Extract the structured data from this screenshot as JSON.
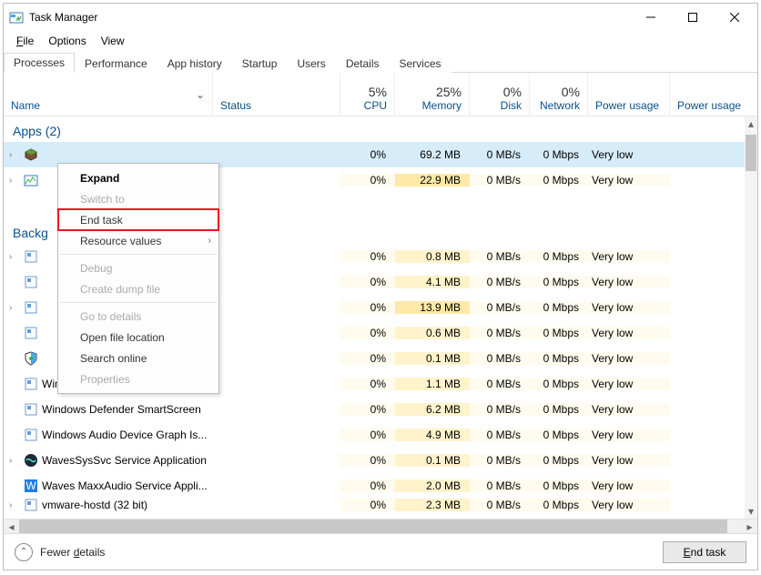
{
  "title": "Task Manager",
  "titlebar": {
    "min": "Minimize",
    "max": "Maximize",
    "close": "Close"
  },
  "menu": {
    "file": "File",
    "options": "Options",
    "view": "View"
  },
  "tabs": [
    "Processes",
    "Performance",
    "App history",
    "Startup",
    "Users",
    "Details",
    "Services"
  ],
  "active_tab": 0,
  "headers": {
    "name": "Name",
    "status": "Status",
    "cpu_top": "5%",
    "cpu_bot": "CPU",
    "mem_top": "25%",
    "mem_bot": "Memory",
    "disk_top": "0%",
    "disk_bot": "Disk",
    "net_top": "0%",
    "net_bot": "Network",
    "power": "Power usage",
    "power2": "Power usage"
  },
  "groups": {
    "apps_label": "Apps (2)",
    "bg_label": "Backg"
  },
  "rows": [
    {
      "arrow": true,
      "name": "",
      "cpu": "0%",
      "mem": "69.2 MB",
      "disk": "0 MB/s",
      "net": "0 Mbps",
      "pw": "Very low",
      "selected": true
    },
    {
      "arrow": true,
      "name": "",
      "cpu": "0%",
      "mem": "22.9 MB",
      "disk": "0 MB/s",
      "net": "0 Mbps",
      "pw": "Very low"
    },
    {
      "gap": true
    },
    {
      "arrow": true,
      "name": "",
      "cpu": "0%",
      "mem": "0.8 MB",
      "disk": "0 MB/s",
      "net": "0 Mbps",
      "pw": "Very low"
    },
    {
      "arrow": false,
      "name": "",
      "cpu": "0%",
      "mem": "4.1 MB",
      "disk": "0 MB/s",
      "net": "0 Mbps",
      "pw": "Very low"
    },
    {
      "arrow": true,
      "name": "",
      "cpu": "0%",
      "mem": "13.9 MB",
      "disk": "0 MB/s",
      "net": "0 Mbps",
      "pw": "Very low"
    },
    {
      "arrow": false,
      "name": "",
      "cpu": "0%",
      "mem": "0.6 MB",
      "disk": "0 MB/s",
      "net": "0 Mbps",
      "pw": "Very low"
    },
    {
      "arrow": false,
      "name": "",
      "cpu": "0%",
      "mem": "0.1 MB",
      "disk": "0 MB/s",
      "net": "0 Mbps",
      "pw": "Very low",
      "shield": true
    },
    {
      "arrow": false,
      "name": "Windows Security Health Service",
      "cpu": "0%",
      "mem": "1.1 MB",
      "disk": "0 MB/s",
      "net": "0 Mbps",
      "pw": "Very low"
    },
    {
      "arrow": false,
      "name": "Windows Defender SmartScreen",
      "cpu": "0%",
      "mem": "6.2 MB",
      "disk": "0 MB/s",
      "net": "0 Mbps",
      "pw": "Very low"
    },
    {
      "arrow": false,
      "name": "Windows Audio Device Graph Is...",
      "cpu": "0%",
      "mem": "4.9 MB",
      "disk": "0 MB/s",
      "net": "0 Mbps",
      "pw": "Very low"
    },
    {
      "arrow": true,
      "name": "WavesSysSvc Service Application",
      "cpu": "0%",
      "mem": "0.1 MB",
      "disk": "0 MB/s",
      "net": "0 Mbps",
      "pw": "Very low",
      "waves": true
    },
    {
      "arrow": false,
      "name": "Waves MaxxAudio Service Appli...",
      "cpu": "0%",
      "mem": "2.0 MB",
      "disk": "0 MB/s",
      "net": "0 Mbps",
      "pw": "Very low",
      "wavesblue": true
    },
    {
      "arrow": true,
      "name": "vmware-hostd (32 bit)",
      "cpu": "0%",
      "mem": "2.3 MB",
      "disk": "0 MB/s",
      "net": "0 Mbps",
      "pw": "Very low",
      "cut": true
    }
  ],
  "context_menu": {
    "items": [
      {
        "label": "Expand",
        "bold": true
      },
      {
        "label": "Switch to",
        "disabled": true
      },
      {
        "label": "End task",
        "boxed": true
      },
      {
        "label": "Resource values",
        "sub": true
      },
      {
        "label": "Debug",
        "disabled": true
      },
      {
        "label": "Create dump file",
        "disabled": true
      },
      {
        "label": "Go to details",
        "disabled": true
      },
      {
        "label": "Open file location"
      },
      {
        "label": "Search online"
      },
      {
        "label": "Properties",
        "disabled": true
      }
    ]
  },
  "footer": {
    "fewer": "Fewer details",
    "endtask": "End task",
    "underline_char": "d"
  }
}
